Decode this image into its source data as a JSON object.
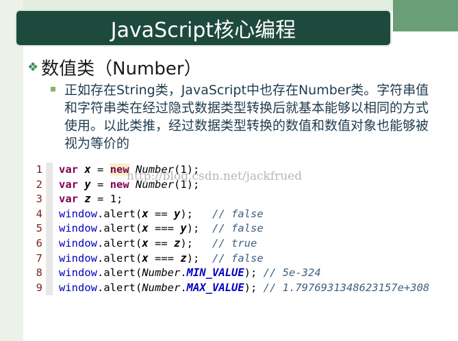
{
  "slide": {
    "title": "JavaScript核心编程",
    "heading": "数值类（Number）",
    "paragraph": "正如存在String类，JavaScript中也存在Number类。字符串值和字符串类在经过隐式数据类型转换后就基本能够以相同的方式使用。以此类推，经过数据类型转换的数值和数值对象也能够被视为等价的",
    "watermark": "http://blog.csdn.net/jackfrued"
  },
  "code": {
    "line_numbers": [
      "1",
      "2",
      "3",
      "4",
      "5",
      "6",
      "7",
      "8",
      "9"
    ],
    "lines": [
      [
        {
          "t": "var",
          "c": "kw"
        },
        {
          "t": " ",
          "c": "plain"
        },
        {
          "t": "x",
          "c": "var"
        },
        {
          "t": " = ",
          "c": "plain"
        },
        {
          "t": "new",
          "c": "kw hl"
        },
        {
          "t": " ",
          "c": "plain"
        },
        {
          "t": "Number",
          "c": "cls"
        },
        {
          "t": "(",
          "c": "plain"
        },
        {
          "t": "1",
          "c": "num"
        },
        {
          "t": ");",
          "c": "plain"
        }
      ],
      [
        {
          "t": "var",
          "c": "kw"
        },
        {
          "t": " ",
          "c": "plain"
        },
        {
          "t": "y",
          "c": "var"
        },
        {
          "t": " = ",
          "c": "plain"
        },
        {
          "t": "new",
          "c": "kw"
        },
        {
          "t": " ",
          "c": "plain"
        },
        {
          "t": "Number",
          "c": "cls"
        },
        {
          "t": "(",
          "c": "plain"
        },
        {
          "t": "1",
          "c": "num"
        },
        {
          "t": ");",
          "c": "plain"
        }
      ],
      [
        {
          "t": "var",
          "c": "kw"
        },
        {
          "t": " ",
          "c": "plain"
        },
        {
          "t": "z",
          "c": "var"
        },
        {
          "t": " = ",
          "c": "plain"
        },
        {
          "t": "1",
          "c": "num"
        },
        {
          "t": ";",
          "c": "plain"
        }
      ],
      [
        {
          "t": "window",
          "c": "win"
        },
        {
          "t": ".alert(",
          "c": "plain"
        },
        {
          "t": "x",
          "c": "var"
        },
        {
          "t": " == ",
          "c": "plain"
        },
        {
          "t": "y",
          "c": "var"
        },
        {
          "t": ");   ",
          "c": "plain"
        },
        {
          "t": "// false",
          "c": "cmt"
        }
      ],
      [
        {
          "t": "window",
          "c": "win"
        },
        {
          "t": ".alert(",
          "c": "plain"
        },
        {
          "t": "x",
          "c": "var"
        },
        {
          "t": " === ",
          "c": "plain"
        },
        {
          "t": "y",
          "c": "var"
        },
        {
          "t": ");  ",
          "c": "plain"
        },
        {
          "t": "// false",
          "c": "cmt"
        }
      ],
      [
        {
          "t": "window",
          "c": "win"
        },
        {
          "t": ".alert(",
          "c": "plain"
        },
        {
          "t": "x",
          "c": "var"
        },
        {
          "t": " == ",
          "c": "plain"
        },
        {
          "t": "z",
          "c": "var"
        },
        {
          "t": ");   ",
          "c": "plain"
        },
        {
          "t": "// true",
          "c": "cmt"
        }
      ],
      [
        {
          "t": "window",
          "c": "win"
        },
        {
          "t": ".alert(",
          "c": "plain"
        },
        {
          "t": "x",
          "c": "var"
        },
        {
          "t": " === ",
          "c": "plain"
        },
        {
          "t": "z",
          "c": "var"
        },
        {
          "t": ");  ",
          "c": "plain"
        },
        {
          "t": "// false",
          "c": "cmt"
        }
      ],
      [
        {
          "t": "window",
          "c": "win"
        },
        {
          "t": ".alert(",
          "c": "plain"
        },
        {
          "t": "Number",
          "c": "cls"
        },
        {
          "t": ".",
          "c": "plain"
        },
        {
          "t": "MIN_VALUE",
          "c": "cst"
        },
        {
          "t": "); ",
          "c": "plain"
        },
        {
          "t": "// 5e-324",
          "c": "cmt"
        }
      ],
      [
        {
          "t": "window",
          "c": "win"
        },
        {
          "t": ".alert(",
          "c": "plain"
        },
        {
          "t": "Number",
          "c": "cls"
        },
        {
          "t": ".",
          "c": "plain"
        },
        {
          "t": "MAX_VALUE",
          "c": "cst"
        },
        {
          "t": "); ",
          "c": "plain"
        },
        {
          "t": "// 1.7976931348623157e+308",
          "c": "cmt"
        }
      ]
    ]
  }
}
